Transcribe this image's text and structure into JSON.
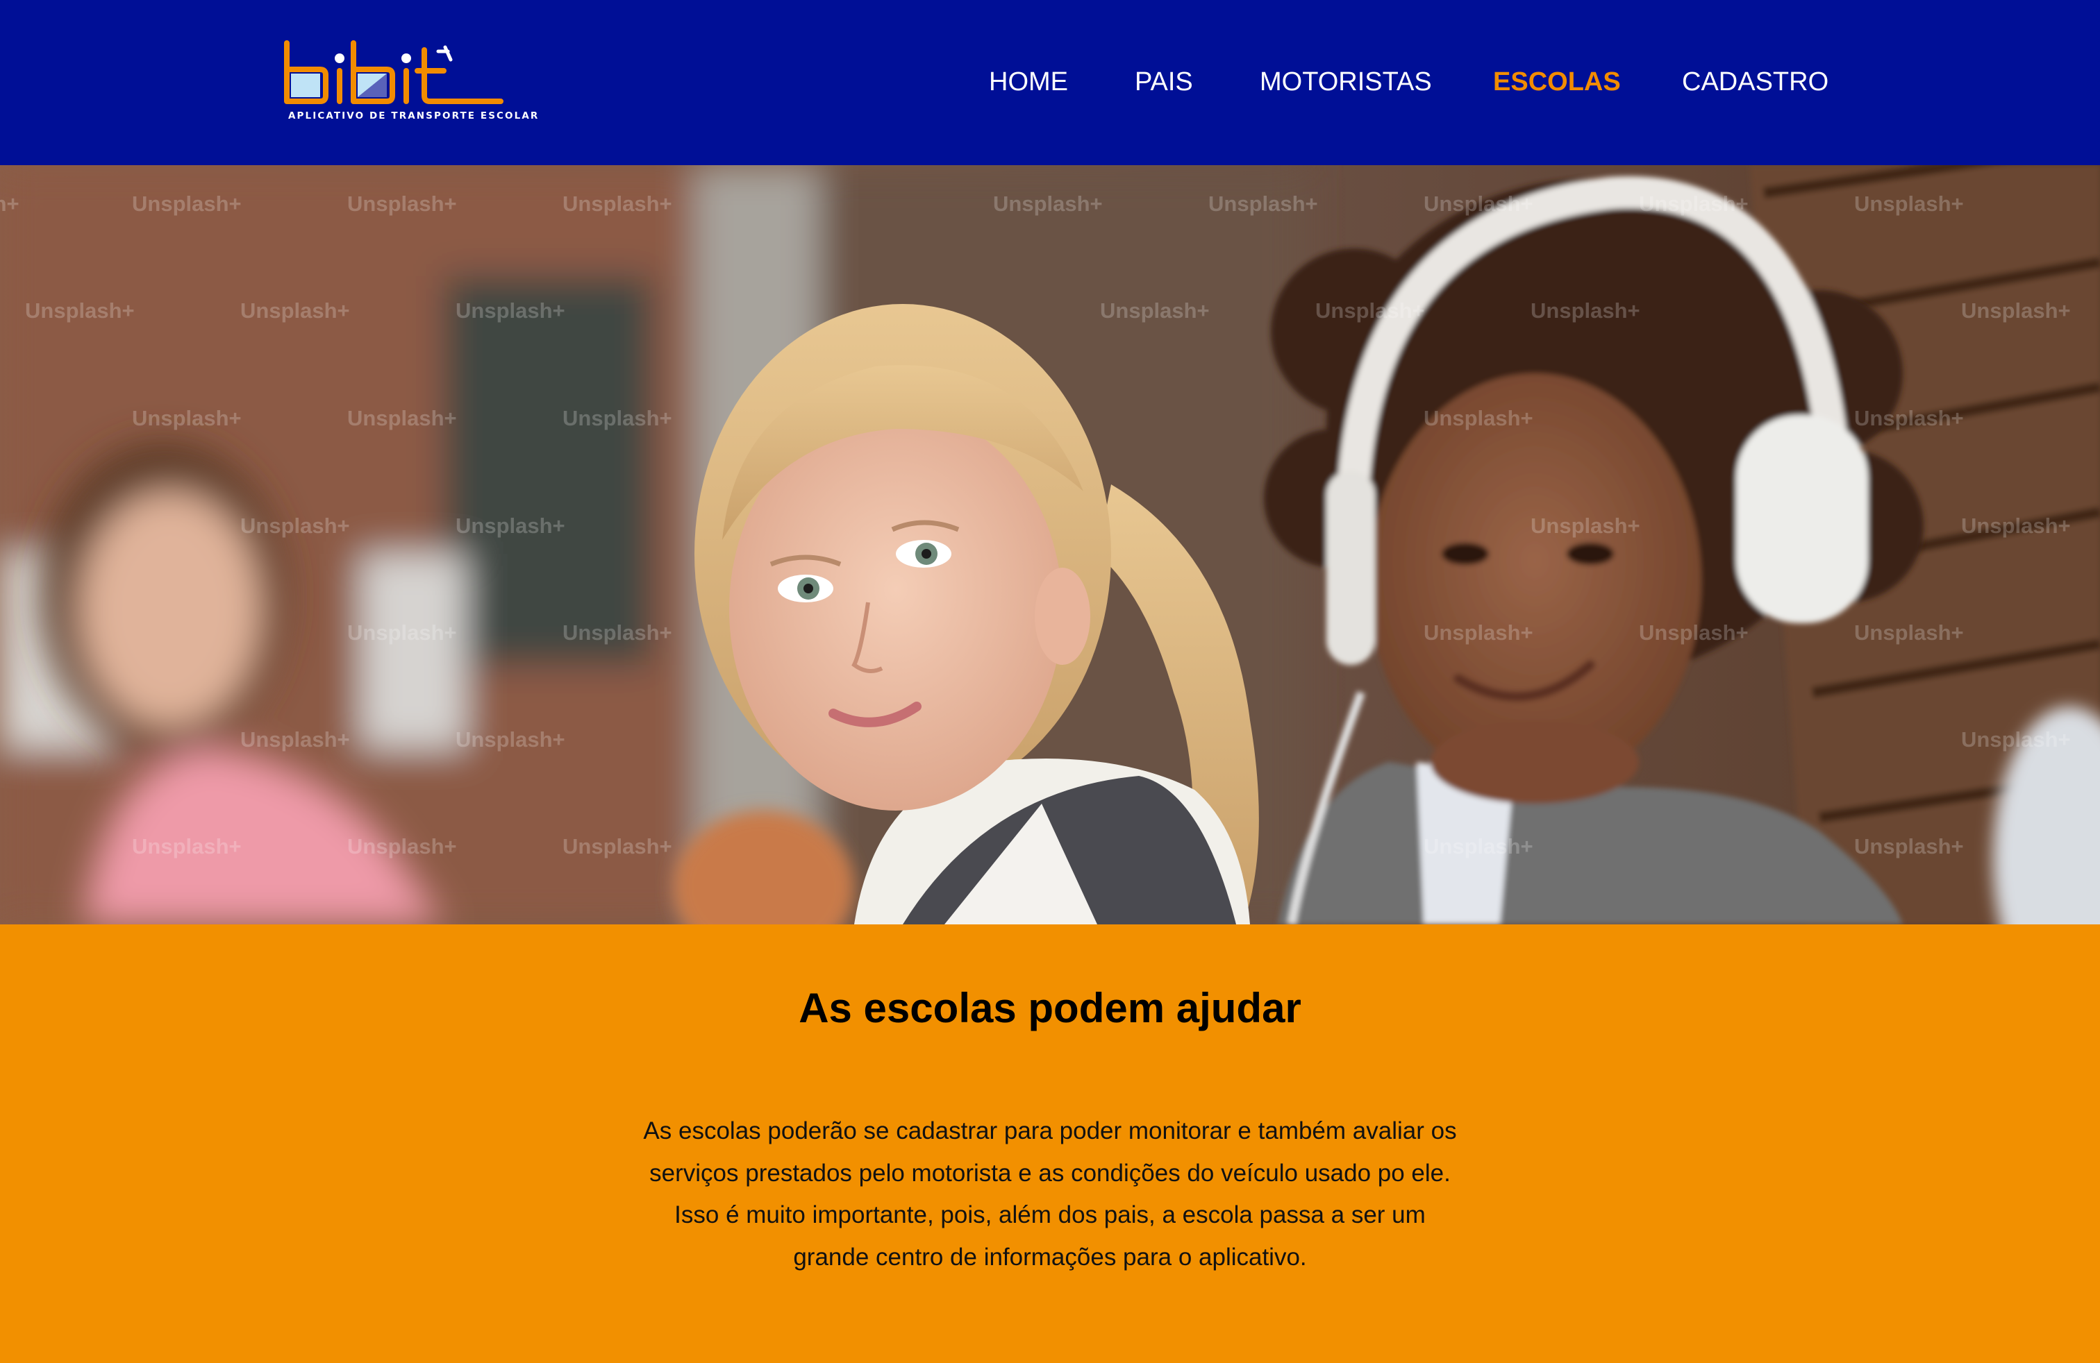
{
  "brand": {
    "logo_text": "bibit",
    "tagline": "APLICATIVO DE TRANSPORTE ESCOLAR"
  },
  "nav": {
    "items": [
      {
        "label": "HOME",
        "active": false
      },
      {
        "label": "PAIS",
        "active": false
      },
      {
        "label": "MOTORISTAS",
        "active": false
      },
      {
        "label": "ESCOLAS",
        "active": true
      },
      {
        "label": "CADASTRO",
        "active": false
      }
    ]
  },
  "hero": {
    "watermark": "Unsplash+"
  },
  "section": {
    "title": "As escolas podem ajudar",
    "paragraph_lines": [
      "As escolas poderão se cadastrar para poder monitorar e também avaliar os",
      "serviços prestados pelo motorista e as condições do veículo usado po ele.",
      "Isso é muito importante, pois, além dos pais, a escola passa a ser um",
      "grande centro de informações para o aplicativo."
    ]
  },
  "colors": {
    "header_bg": "#000f96",
    "accent": "#f28c00",
    "section_bg": "#f29000",
    "nav_text": "#ffffff"
  }
}
